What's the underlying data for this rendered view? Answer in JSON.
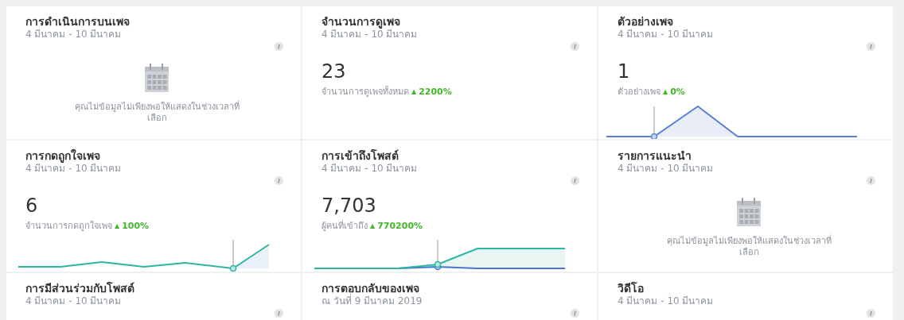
{
  "cards": [
    {
      "kind": "empty",
      "title": "การดำเนินการบนเพจ",
      "date": "4 มีนาคม - 10 มีนาคม",
      "message": "คุณไม่ข้อมูลไม่เพียงพอให้แสดงในช่วงเวลาที่เลือก"
    },
    {
      "kind": "metric",
      "title": "จำนวนการดูเพจ",
      "date": "4 มีนาคม - 10 มีนาคม",
      "value": "23",
      "label": "จำนวนการดูเพจทั้งหมด",
      "arrow": "▲",
      "change": "2200%"
    },
    {
      "kind": "metric",
      "title": "ตัวอย่างเพจ",
      "date": "4 มีนาคม - 10 มีนาคม",
      "value": "1",
      "label": "ตัวอย่างเพจ",
      "arrow": "▲",
      "change": "0%",
      "sparkline": {
        "kind": "peak"
      }
    },
    {
      "kind": "metric",
      "title": "การกดถูกใจเพจ",
      "date": "4 มีนาคม - 10 มีนาคม",
      "value": "6",
      "label": "จำนวนการกดถูกใจเพจ",
      "arrow": "▲",
      "change": "100%",
      "sparkline": {
        "kind": "zigzag"
      }
    },
    {
      "kind": "metric",
      "title": "การเข้าถึงโพสต์",
      "date": "4 มีนาคม - 10 มีนาคม",
      "value": "7,703",
      "label": "ผู้คนที่เข้าถึง",
      "arrow": "▲",
      "change": "770200%",
      "sparkline": {
        "kind": "rise"
      }
    },
    {
      "kind": "empty",
      "title": "รายการแนะนำ",
      "date": "4 มีนาคม - 10 มีนาคม",
      "message": "คุณไม่ข้อมูลไม่เพียงพอให้แสดงในช่วงเวลาที่เลือก"
    },
    {
      "kind": "header",
      "title": "การมีส่วนร่วมกับโพสต์",
      "date": "4 มีนาคม - 10 มีนาคม"
    },
    {
      "kind": "header",
      "title": "การตอบกลับของเพจ",
      "date": "ณ วันที่ 9 มีนาคม 2019"
    },
    {
      "kind": "header",
      "title": "วิดีโอ",
      "date": "4 มีนาคม - 10 มีนาคม"
    }
  ]
}
